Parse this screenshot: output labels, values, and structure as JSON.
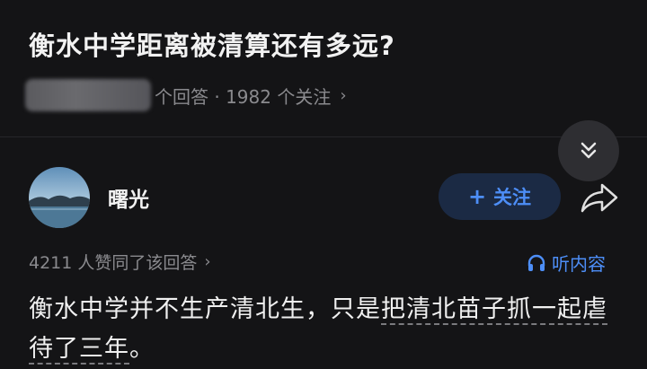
{
  "question": {
    "title": "衡水中学距离被清算还有多远?",
    "answers_suffix": "个回答 · 1982 个关注",
    "chevron": "›"
  },
  "author": {
    "name": "曙光"
  },
  "follow_button": {
    "plus": "+",
    "label": "关注"
  },
  "answer": {
    "votes_text": "4211 人赞同了该回答",
    "chevron": "›",
    "listen_label": "听内容",
    "body_plain": "衡水中学并不生产清北生，只是",
    "body_underlined": "把清北苗子抓一起虐待了三年",
    "body_end": "。"
  },
  "colors": {
    "background": "#141416",
    "accent": "#4d8ef7",
    "muted": "#8a8a8e"
  },
  "icons": {
    "collapse": "double-chevron-down-icon",
    "share": "share-arrow-icon",
    "headphones": "headphones-icon"
  }
}
